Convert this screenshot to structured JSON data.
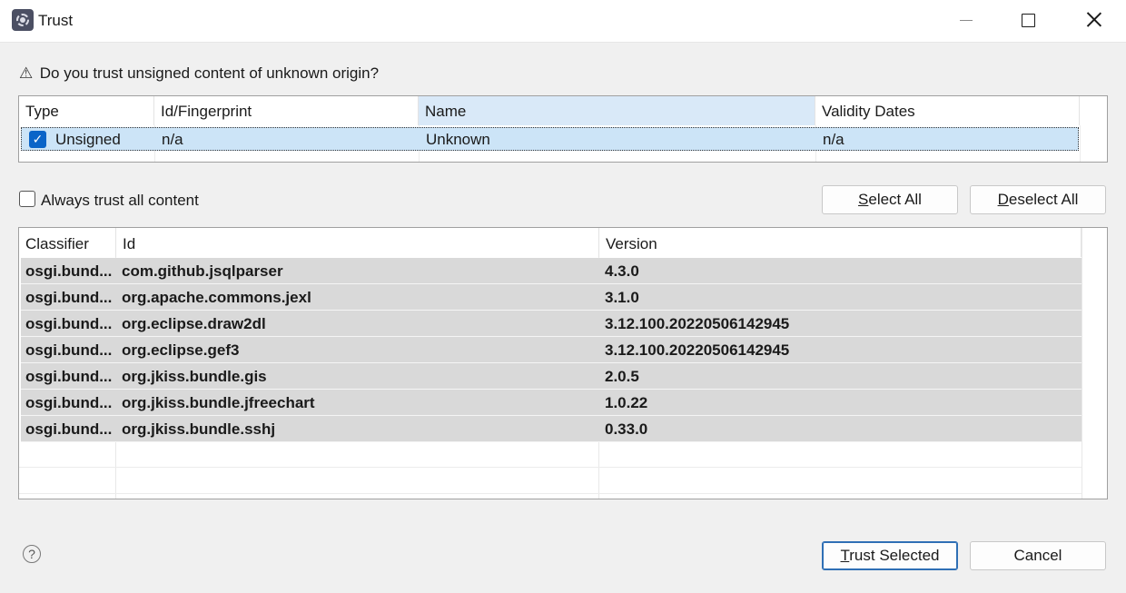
{
  "window": {
    "title": "Trust",
    "app_icon": "eclipse-app-icon"
  },
  "dialog": {
    "question_icon": "warning-icon",
    "question": "Do you trust unsigned content of unknown origin?"
  },
  "cert_table": {
    "columns": [
      "Type",
      "Id/Fingerprint",
      "Name",
      "Validity Dates"
    ],
    "sorted_column": "Name",
    "rows": [
      {
        "checked": true,
        "type": "Unsigned",
        "fingerprint": "n/a",
        "name": "Unknown",
        "validity": "n/a"
      }
    ]
  },
  "always_trust": {
    "label": "Always trust all content",
    "checked": false
  },
  "buttons": {
    "select_all": {
      "mnemonic": "S",
      "rest": "elect All"
    },
    "deselect_all": {
      "mnemonic": "D",
      "rest": "eselect All"
    },
    "trust_selected": {
      "mnemonic": "T",
      "rest": "rust Selected"
    },
    "cancel": "Cancel"
  },
  "bundle_table": {
    "columns": [
      "Classifier",
      "Id",
      "Version"
    ],
    "rows": [
      {
        "classifier": "osgi.bund...",
        "id": "com.github.jsqlparser",
        "version": "4.3.0"
      },
      {
        "classifier": "osgi.bund...",
        "id": "org.apache.commons.jexl",
        "version": "3.1.0"
      },
      {
        "classifier": "osgi.bund...",
        "id": "org.eclipse.draw2dl",
        "version": "3.12.100.20220506142945"
      },
      {
        "classifier": "osgi.bund...",
        "id": "org.eclipse.gef3",
        "version": "3.12.100.20220506142945"
      },
      {
        "classifier": "osgi.bund...",
        "id": "org.jkiss.bundle.gis",
        "version": "2.0.5"
      },
      {
        "classifier": "osgi.bund...",
        "id": "org.jkiss.bundle.jfreechart",
        "version": "1.0.22"
      },
      {
        "classifier": "osgi.bund...",
        "id": "org.jkiss.bundle.sshj",
        "version": "0.33.0"
      }
    ]
  },
  "help": {
    "icon": "help-icon",
    "glyph": "?"
  },
  "colors": {
    "selection": "#cce4f7",
    "sorted_header": "#d9e9f8",
    "checkbox_accent": "#0a64c8",
    "bundle_row": "#d9d9d9",
    "default_button_border": "#2f6fb5"
  }
}
